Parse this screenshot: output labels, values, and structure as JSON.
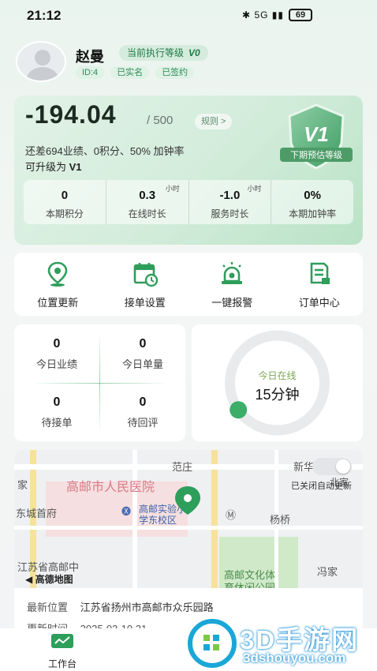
{
  "status_bar": {
    "time": "21:12",
    "battery": "69",
    "net": "5G"
  },
  "profile": {
    "name": "赵曼",
    "level_label": "当前执行等级",
    "level_value": "V0",
    "tags": [
      "ID:4",
      "已实名",
      "已签约"
    ]
  },
  "performance": {
    "amount": "-194.04",
    "total": "/ 500",
    "rule_button": "规则 >",
    "gap_text": "还差694业绩、0积分、50% 加钟率",
    "upgrade_prefix": "可升级为",
    "upgrade_level": "V1",
    "badge_level": "V1",
    "badge_caption": "下期预估等级",
    "stats": [
      {
        "value": "0",
        "unit": "",
        "label": "本期积分"
      },
      {
        "value": "0.3",
        "unit": "小时",
        "label": "在线时长"
      },
      {
        "value": "-1.0",
        "unit": "小时",
        "label": "服务时长"
      },
      {
        "value": "0%",
        "unit": "",
        "label": "本期加钟率"
      }
    ]
  },
  "actions": [
    {
      "label": "位置更新",
      "icon": "location-pin-icon"
    },
    {
      "label": "接单设置",
      "icon": "calendar-clock-icon"
    },
    {
      "label": "一键报警",
      "icon": "alarm-light-icon"
    },
    {
      "label": "订单中心",
      "icon": "document-icon"
    }
  ],
  "today": {
    "items": [
      {
        "value": "0",
        "label": "今日业绩"
      },
      {
        "value": "0",
        "label": "今日单量"
      },
      {
        "value": "0",
        "label": "待接单"
      },
      {
        "value": "0",
        "label": "待回评"
      }
    ],
    "online_label": "今日在线",
    "online_value": "15分钟",
    "online_fraction": 0.02
  },
  "map": {
    "labels": [
      "范庄",
      "新华",
      "家",
      "高邮市人民医院",
      "东城首府",
      "高邮实验小",
      "学东校区",
      "杨桥",
      "江苏省高邮中",
      "高德地图",
      "高邮文化体",
      "育休闲公园",
      "冯家",
      "北家"
    ],
    "auto_update_label": "已关闭自动更新",
    "latest_location_key": "最新位置",
    "latest_location_value": "江苏省扬州市高邮市众乐园路",
    "update_time_key": "更新时间",
    "update_time_value": "2025-03-10 21"
  },
  "bottom_nav": {
    "workbench": "工作台"
  },
  "watermark": {
    "title": "3D手游网",
    "url": "3dshouyou.com"
  },
  "colors": {
    "accent": "#2e9e5b",
    "card_green": "#d2ecda"
  }
}
